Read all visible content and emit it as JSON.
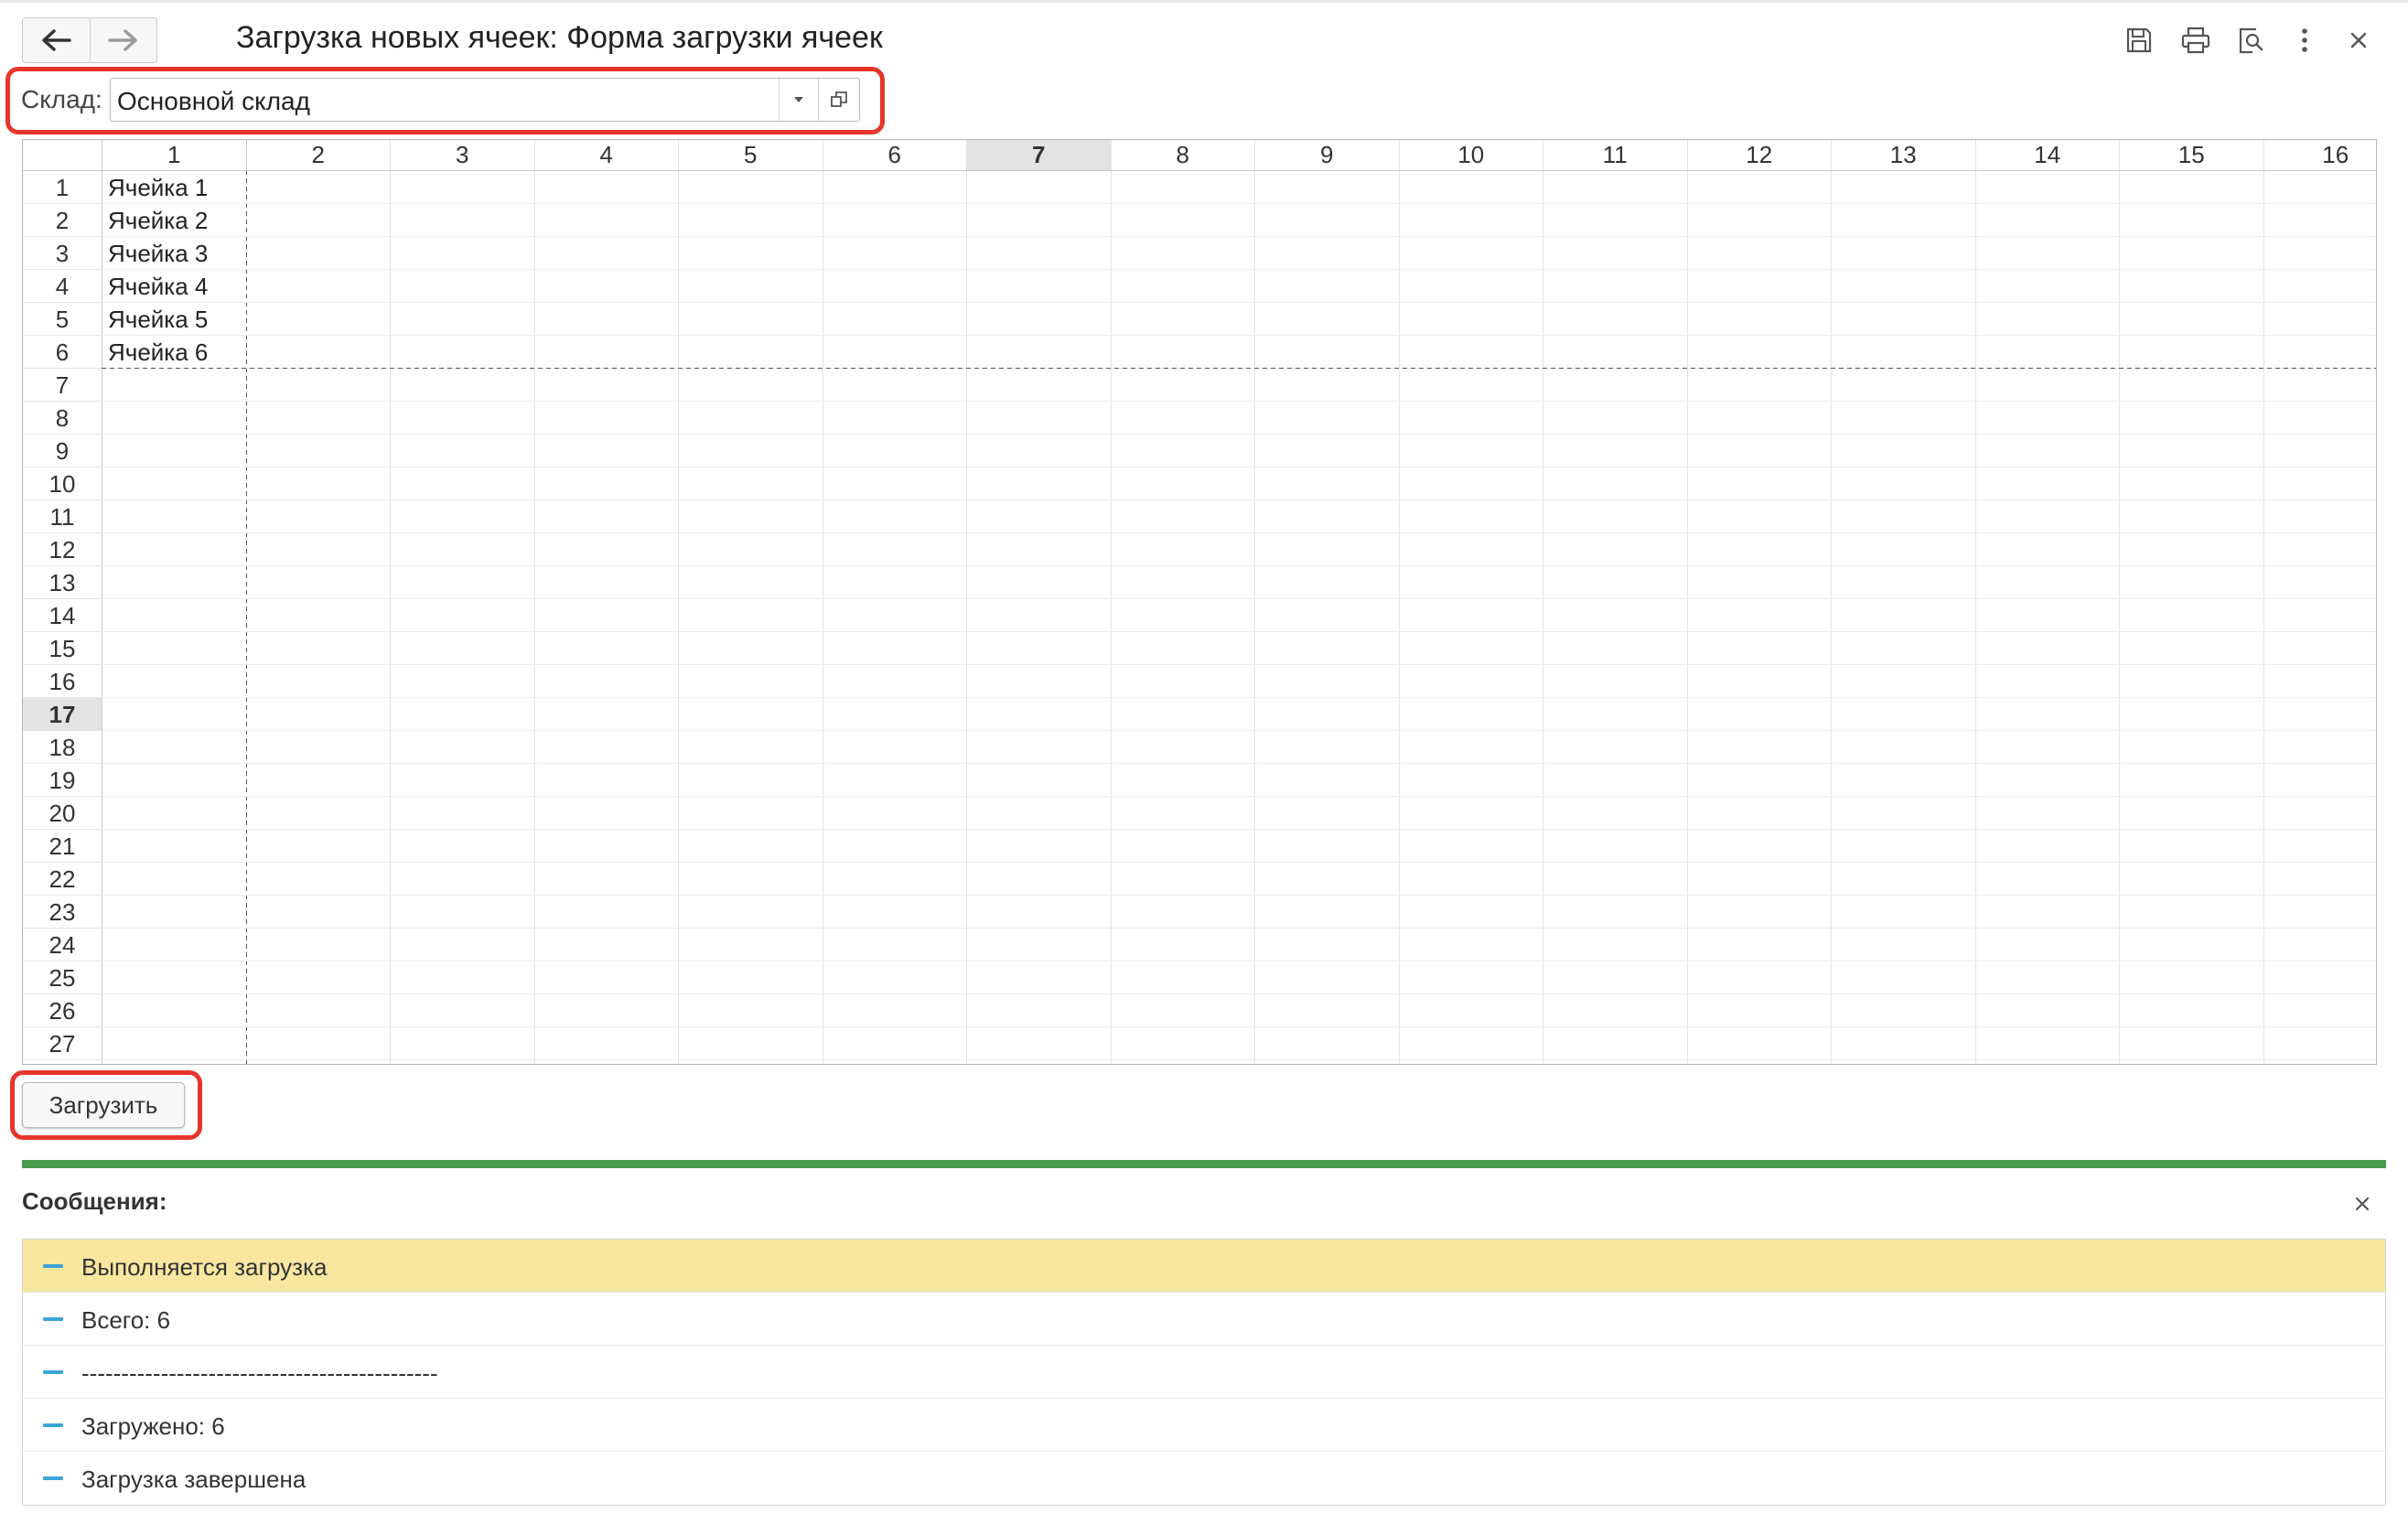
{
  "header": {
    "title": "Загрузка новых ячеек: Форма загрузки ячеек",
    "back_icon": "arrow-left-icon",
    "forward_icon": "arrow-right-icon",
    "toolbar_icons": [
      "save-icon",
      "print-icon",
      "preview-icon",
      "more-icon",
      "close-icon"
    ]
  },
  "warehouse": {
    "label": "Склад:",
    "value": "Основной склад"
  },
  "sheet": {
    "columns": [
      "1",
      "2",
      "3",
      "4",
      "5",
      "6",
      "7",
      "8",
      "9",
      "10",
      "11",
      "12",
      "13",
      "14",
      "15",
      "16"
    ],
    "rows": [
      "1",
      "2",
      "3",
      "4",
      "5",
      "6",
      "7",
      "8",
      "9",
      "10",
      "11",
      "12",
      "13",
      "14",
      "15",
      "16",
      "17",
      "18",
      "19",
      "20",
      "21",
      "22",
      "23",
      "24",
      "25",
      "26",
      "27"
    ],
    "selected_column": "7",
    "selected_row": "17",
    "cells": [
      "Ячейка 1",
      "Ячейка 2",
      "Ячейка 3",
      "Ячейка 4",
      "Ячейка 5",
      "Ячейка 6"
    ]
  },
  "actions": {
    "load_label": "Загрузить"
  },
  "messages": {
    "title": "Сообщения:",
    "items": [
      {
        "text": "Выполняется загрузка",
        "highlight": true
      },
      {
        "text": "Всего: 6",
        "highlight": false
      },
      {
        "text": "---------------------------------------------",
        "highlight": false
      },
      {
        "text": "Загружено: 6",
        "highlight": false
      },
      {
        "text": "Загрузка завершена",
        "highlight": false
      }
    ]
  },
  "colors": {
    "highlight_frame": "#e8352c",
    "message_bar": "#4a9950",
    "warning_row": "#f9e7a0",
    "message_dash": "#3aa5d9"
  }
}
